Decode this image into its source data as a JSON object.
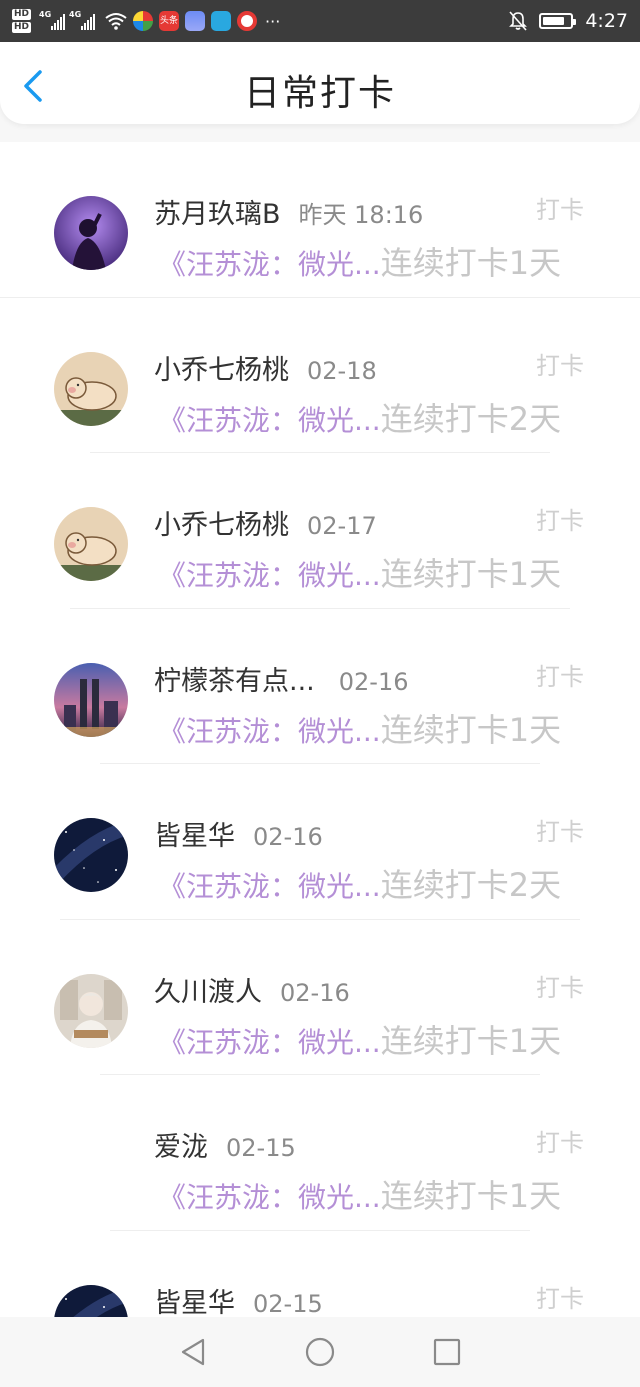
{
  "status_bar": {
    "network_labels": [
      "HD",
      "HD",
      "4G",
      "4G"
    ],
    "app_icons": [
      "clover-app-icon",
      "toutiao-app-icon",
      "music-app-icon",
      "browser-app-icon",
      "video-app-icon"
    ],
    "toutiao_label": "头条",
    "more": "···",
    "time": "4:27",
    "battery_level": 0.8
  },
  "header": {
    "title": "日常打卡",
    "accent_color": "#1a9af0"
  },
  "colors": {
    "book_link": "#b48fd6",
    "streak": "#c7c7c7",
    "checkin": "#cfcfcf"
  },
  "rows": [
    {
      "name": "苏月玖璃B",
      "time": "昨天 18:16",
      "checkin": "打卡",
      "book": "《汪苏泷：微光...",
      "streak": "连续打卡1天",
      "avatar": "purple-girl-avatar"
    },
    {
      "name": "小乔七杨桃",
      "time": "02-18",
      "checkin": "打卡",
      "book": "《汪苏泷：微光...",
      "streak": "连续打卡2天",
      "avatar": "pig-avatar"
    },
    {
      "name": "小乔七杨桃",
      "time": "02-17",
      "checkin": "打卡",
      "book": "《汪苏泷：微光...",
      "streak": "连续打卡1天",
      "avatar": "pig-avatar"
    },
    {
      "name": "柠檬茶有点...",
      "time": "02-16",
      "checkin": "打卡",
      "book": "《汪苏泷：微光...",
      "streak": "连续打卡1天",
      "avatar": "city-night-avatar"
    },
    {
      "name": "皆星华",
      "time": "02-16",
      "checkin": "打卡",
      "book": "《汪苏泷：微光...",
      "streak": "连续打卡2天",
      "avatar": "starry-sky-avatar"
    },
    {
      "name": "久川渡人",
      "time": "02-16",
      "checkin": "打卡",
      "book": "《汪苏泷：微光...",
      "streak": "连续打卡1天",
      "avatar": "anime-boy-avatar"
    },
    {
      "name": "爱泷",
      "time": "02-15",
      "checkin": "打卡",
      "book": "《汪苏泷：微光...",
      "streak": "连续打卡1天",
      "avatar": "none"
    },
    {
      "name": "皆星华",
      "time": "02-15",
      "checkin": "打卡",
      "book": "",
      "streak": "",
      "avatar": "starry-sky-avatar"
    }
  ],
  "nav": {
    "buttons": [
      "back-triangle-icon",
      "home-circle-icon",
      "recents-square-icon"
    ]
  }
}
